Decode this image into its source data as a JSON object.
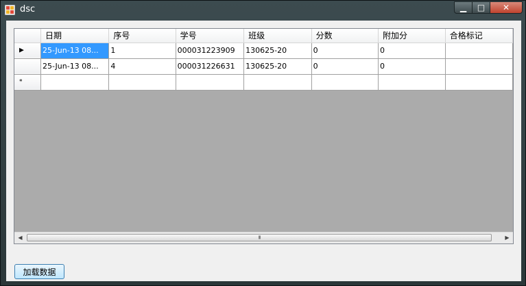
{
  "window": {
    "title": "dsc"
  },
  "controls": {
    "minimize": "▁",
    "maximize": "□",
    "close": "✕"
  },
  "grid": {
    "columns": [
      "日期",
      "序号",
      "学号",
      "班级",
      "分数",
      "附加分",
      "合格标记"
    ],
    "rows": [
      {
        "marker": "▶",
        "cells": [
          "25-Jun-13 08...",
          "1",
          "000031223909",
          "130625-20",
          "0",
          "0",
          ""
        ]
      },
      {
        "marker": "",
        "cells": [
          "25-Jun-13 08...",
          "4",
          "000031226631",
          "130625-20",
          "0",
          "0",
          ""
        ]
      }
    ],
    "new_row_marker": "*",
    "scroll_grip": "III"
  },
  "buttons": {
    "load": "加载数据"
  },
  "colors": {
    "selection": "#3399ff",
    "grid_background": "#ababab",
    "client_background": "#f0f0f0"
  }
}
